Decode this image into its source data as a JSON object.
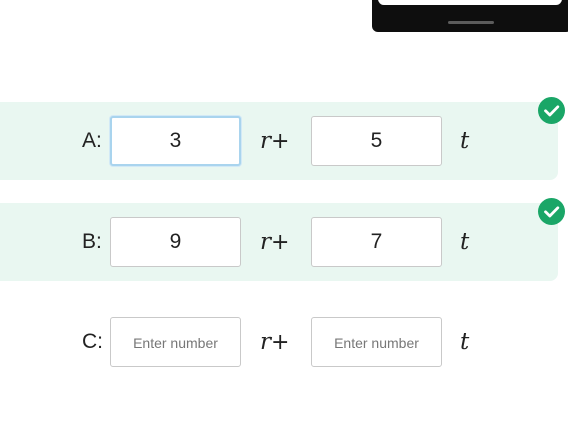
{
  "colors": {
    "correct_row_bg": "#e9f7f1",
    "check_green": "#1aa667",
    "focus_border": "#a9d4ee",
    "field_border": "#c9c9c9"
  },
  "rows": [
    {
      "label": "A:",
      "input1": {
        "value": "3",
        "placeholder": "Enter number"
      },
      "var1": "r",
      "operator": "+",
      "input2": {
        "value": "5",
        "placeholder": "Enter number"
      },
      "var2": "t",
      "status": "correct",
      "status_icon": "check-circle-icon"
    },
    {
      "label": "B:",
      "input1": {
        "value": "9",
        "placeholder": "Enter number"
      },
      "var1": "r",
      "operator": "+",
      "input2": {
        "value": "7",
        "placeholder": "Enter number"
      },
      "var2": "t",
      "status": "correct",
      "status_icon": "check-circle-icon"
    },
    {
      "label": "C:",
      "input1": {
        "value": "",
        "placeholder": "Enter number"
      },
      "var1": "r",
      "operator": "+",
      "input2": {
        "value": "",
        "placeholder": "Enter number"
      },
      "var2": "t",
      "status": "unanswered"
    }
  ]
}
